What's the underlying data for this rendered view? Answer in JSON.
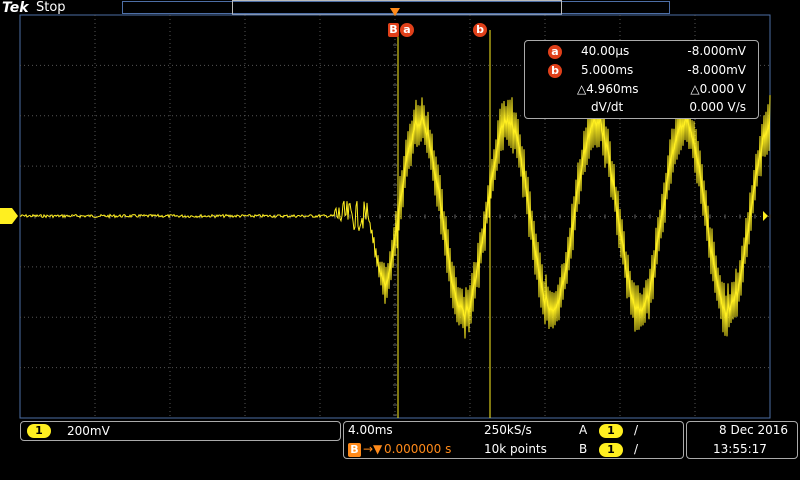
{
  "header": {
    "brand": "Tek",
    "status": "Stop"
  },
  "cursors": {
    "a_label": "a",
    "b_label": "b",
    "trigger_marker": "B",
    "a_time": "40.00µs",
    "a_value": "-8.000mV",
    "b_time": "5.000ms",
    "b_value": "-8.000mV",
    "delta_time": "△4.960ms",
    "delta_value": "△0.000 V",
    "slope_label": "dV/dt",
    "slope_value": "0.000 V/s"
  },
  "channel": {
    "number": "1",
    "scale": "200mV"
  },
  "horizontal": {
    "timebase": "4.00ms",
    "sample_rate": "250kS/s",
    "delay_marker": "B",
    "delay_arrow": "→▼",
    "delay": "0.000000 s",
    "record_length": "10k points"
  },
  "trigger": {
    "a_label": "A",
    "a_source": "1",
    "a_slope": "/",
    "b_label": "B",
    "b_source": "1",
    "b_slope": "/"
  },
  "datetime": {
    "date": "8 Dec  2016",
    "time": "13:55:17"
  },
  "colors": {
    "trace": "#ffef20",
    "cursor": "#e0401a",
    "grid": "#555",
    "border": "#4d6ea5"
  }
}
